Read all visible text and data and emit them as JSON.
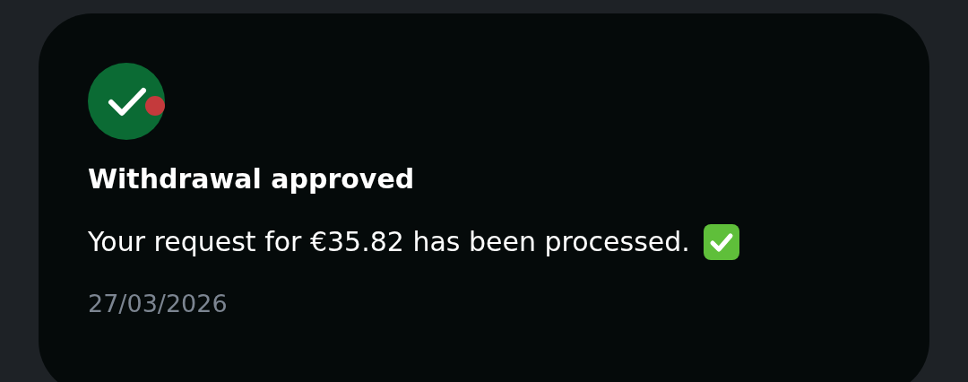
{
  "notification": {
    "title": "Withdrawal approved",
    "message": "Your request for €35.82 has been processed.",
    "date": "27/03/2026",
    "unread": true
  }
}
